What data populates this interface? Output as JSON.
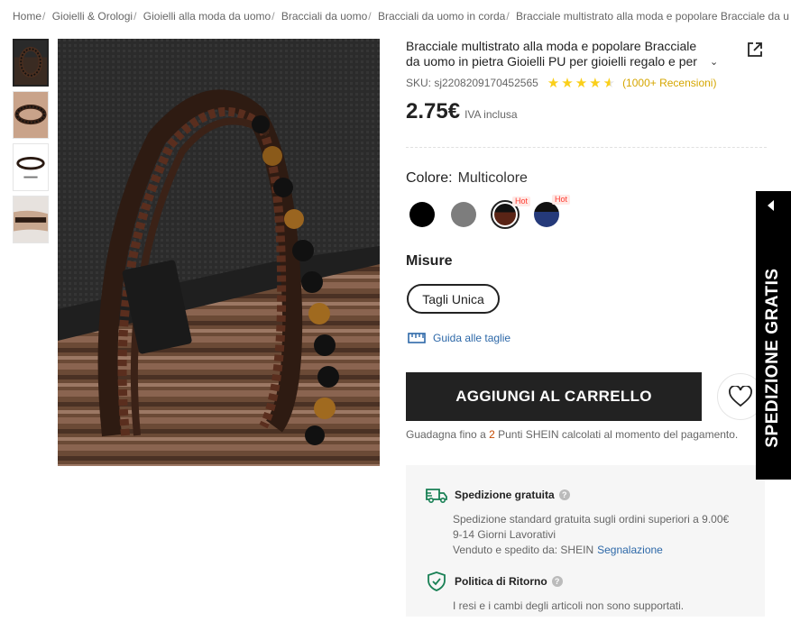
{
  "breadcrumb": [
    "Home",
    "Gioielli & Orologi",
    "Gioielli alla moda da uomo",
    "Bracciali da uomo",
    "Bracciali da uomo in corda",
    "Bracciale multistrato alla moda e popolare Bracciale da u"
  ],
  "breadcrumb_separator": "/",
  "product": {
    "title": "Bracciale multistrato alla moda e popolare Bracciale da uomo in pietra Gioielli PU per gioielli regalo e per look",
    "sku": "SKU: sj2208209170452565",
    "rating": 4.5,
    "reviews": "(1000+ Recensioni)",
    "price": "2.75€",
    "vat": "IVA inclusa"
  },
  "color": {
    "label": "Colore:",
    "value": "Multicolore",
    "swatches": [
      {
        "name": "black",
        "hot": false,
        "selected": false
      },
      {
        "name": "grey",
        "hot": false,
        "selected": false
      },
      {
        "name": "brown-multicolor",
        "hot": true,
        "selected": true
      },
      {
        "name": "navy-black",
        "hot": true,
        "selected": false
      }
    ],
    "hot_label": "Hot"
  },
  "size": {
    "label": "Misure",
    "option": "Tagli Unica",
    "guide": "Guida alle taglie"
  },
  "cart": {
    "add_label": "AGGIUNGI AL CARRELLO"
  },
  "points": {
    "prefix": "Guadagna fino a",
    "number": "2",
    "suffix": "Punti SHEIN calcolati al momento del pagamento."
  },
  "shipping": {
    "title": "Spedizione gratuita",
    "line1": "Spedizione standard gratuita sugli ordini superiori a 9.00€",
    "line2": "9-14 Giorni Lavorativi",
    "seller_prefix": "Venduto e spedito da: SHEIN",
    "report": "Segnalazione"
  },
  "returns": {
    "title": "Politica di Ritorno",
    "text": "I resi e i cambi degli articoli non sono supportati."
  },
  "side_banner": {
    "text": "SPEDIZIONE GRATIS"
  },
  "colors": {
    "accent_star": "#facf19",
    "reviews": "#d5a600",
    "link": "#2d68a8",
    "hot_text": "#ff3b30",
    "points_number": "#c44a01",
    "shipping_icon": "#198055"
  }
}
